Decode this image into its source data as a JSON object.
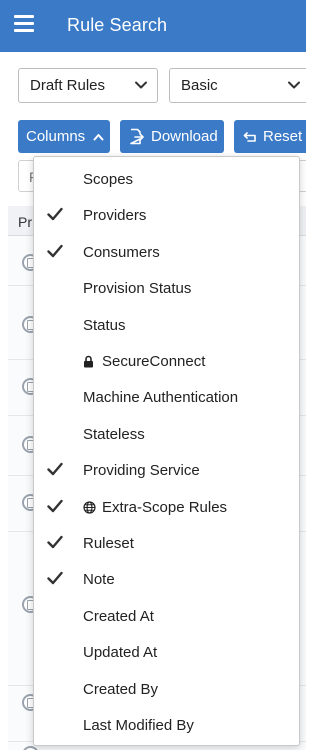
{
  "header": {
    "title": "Rule Search",
    "menu_icon": "hamburger-icon",
    "color": "#3a7ac7"
  },
  "filters": {
    "rule_type": {
      "value": "Draft Rules"
    },
    "mode": {
      "value": "Basic"
    }
  },
  "toolbar": {
    "columns_label": "Columns",
    "download_label": "Download",
    "reset_label": "Reset"
  },
  "search": {
    "visible_char": "F"
  },
  "table": {
    "header_partial": "Pr"
  },
  "columns_menu": {
    "items": [
      {
        "label": "Scopes",
        "checked": false,
        "icon": ""
      },
      {
        "label": "Providers",
        "checked": true,
        "icon": ""
      },
      {
        "label": "Consumers",
        "checked": true,
        "icon": ""
      },
      {
        "label": "Provision Status",
        "checked": false,
        "icon": ""
      },
      {
        "label": "Status",
        "checked": false,
        "icon": ""
      },
      {
        "label": "SecureConnect",
        "checked": false,
        "icon": "lock-icon"
      },
      {
        "label": "Machine Authentication",
        "checked": false,
        "icon": ""
      },
      {
        "label": "Stateless",
        "checked": false,
        "icon": ""
      },
      {
        "label": "Providing Service",
        "checked": true,
        "icon": ""
      },
      {
        "label": "Extra-Scope Rules",
        "checked": true,
        "icon": "globe-icon"
      },
      {
        "label": "Ruleset",
        "checked": true,
        "icon": ""
      },
      {
        "label": "Note",
        "checked": true,
        "icon": ""
      },
      {
        "label": "Created At",
        "checked": false,
        "icon": ""
      },
      {
        "label": "Updated At",
        "checked": false,
        "icon": ""
      },
      {
        "label": "Created By",
        "checked": false,
        "icon": ""
      },
      {
        "label": "Last Modified By",
        "checked": false,
        "icon": ""
      }
    ]
  }
}
